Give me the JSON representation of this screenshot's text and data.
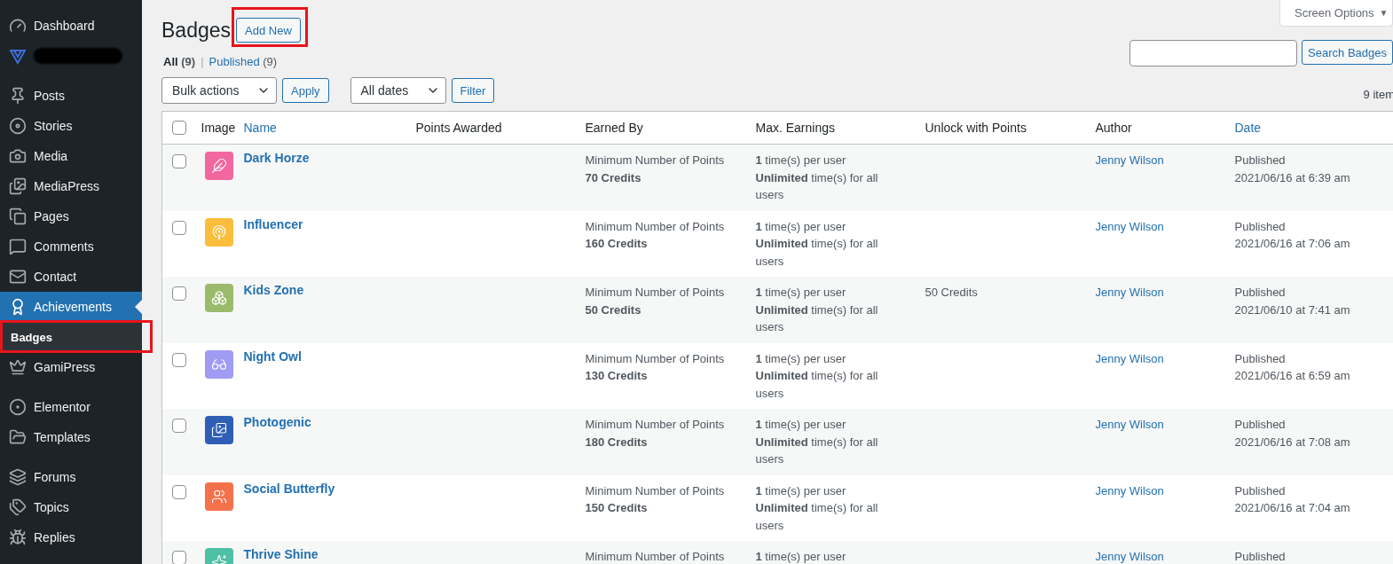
{
  "sidebar": {
    "groups": [
      [
        {
          "label": "Dashboard",
          "selected": false
        },
        {
          "kind": "redacted",
          "selected": false
        }
      ],
      [
        {
          "label": "Posts",
          "selected": false
        },
        {
          "label": "Stories",
          "selected": false
        },
        {
          "label": "Media",
          "selected": false
        },
        {
          "label": "MediaPress",
          "selected": false
        },
        {
          "label": "Pages",
          "selected": false
        },
        {
          "label": "Comments",
          "selected": false
        },
        {
          "label": "Contact",
          "selected": false
        },
        {
          "label": "Achievements",
          "selected": true,
          "children": [
            {
              "label": "Badges",
              "selected": true,
              "highlighted": true
            }
          ]
        },
        {
          "label": "GamiPress",
          "selected": false
        }
      ],
      [
        {
          "label": "Elementor",
          "selected": false
        },
        {
          "label": "Templates",
          "selected": false
        }
      ],
      [
        {
          "label": "Forums",
          "selected": false
        },
        {
          "label": "Topics",
          "selected": false
        },
        {
          "label": "Replies",
          "selected": false
        }
      ]
    ]
  },
  "page_title": "Badges",
  "add_new": {
    "label": "Add New",
    "highlighted": true
  },
  "screen_options": {
    "label": "Screen Options",
    "caret": "▼"
  },
  "views": [
    {
      "label": "All",
      "count": "(9)",
      "selected": true
    },
    {
      "label": "Published",
      "count": "(9)",
      "selected": false
    }
  ],
  "views_separator": "|",
  "bulk_actions": {
    "value": "Bulk actions",
    "button": "Apply"
  },
  "date_filter": {
    "value": "All dates",
    "button": "Filter"
  },
  "search": {
    "button": "Search Badges"
  },
  "item_count": "9 item",
  "table": {
    "select_all": {
      "checked": false
    },
    "columns": [
      {
        "label": "Image",
        "sortable": false
      },
      {
        "label": "Name",
        "sortable": true
      },
      {
        "label": "Points Awarded",
        "sortable": false
      },
      {
        "label": "Earned By",
        "sortable": false
      },
      {
        "label": "Max. Earnings",
        "sortable": false
      },
      {
        "label": "Unlock with Points",
        "sortable": false
      },
      {
        "label": "Author",
        "sortable": false
      },
      {
        "label": "Date",
        "sortable": true
      }
    ],
    "rows": [
      {
        "name": "Dark Horze",
        "color": "#f2679f",
        "earned_by": [
          "Minimum Number of Points",
          "70 Credits"
        ],
        "max_earnings": [
          "**1** time(s) per user",
          "**Unlimited** time(s) for all users"
        ],
        "author": "Jenny Wilson",
        "date": [
          "Published",
          "2021/06/16 at 6:39 am"
        ],
        "checked": false
      },
      {
        "name": "Influencer",
        "color": "#fbbd3c",
        "earned_by": [
          "Minimum Number of Points",
          "160 Credits"
        ],
        "max_earnings": [
          "**1** time(s) per user",
          "**Unlimited** time(s) for all users"
        ],
        "author": "Jenny Wilson",
        "date": [
          "Published",
          "2021/06/16 at 7:06 am"
        ],
        "checked": false
      },
      {
        "name": "Kids Zone",
        "color": "#9bbb6c",
        "earned_by": [
          "Minimum Number of Points",
          "50 Credits"
        ],
        "max_earnings": [
          "**1** time(s) per user",
          "**Unlimited** time(s) for all users"
        ],
        "unlock": "50 Credits",
        "author": "Jenny Wilson",
        "date": [
          "Published",
          "2021/06/10 at 7:41 am"
        ],
        "checked": false
      },
      {
        "name": "Night Owl",
        "color": "#a09bf3",
        "earned_by": [
          "Minimum Number of Points",
          "130 Credits"
        ],
        "max_earnings": [
          "**1** time(s) per user",
          "**Unlimited** time(s) for all users"
        ],
        "author": "Jenny Wilson",
        "date": [
          "Published",
          "2021/06/16 at 6:59 am"
        ],
        "checked": false
      },
      {
        "name": "Photogenic",
        "color": "#2f5fb5",
        "earned_by": [
          "Minimum Number of Points",
          "180 Credits"
        ],
        "max_earnings": [
          "**1** time(s) per user",
          "**Unlimited** time(s) for all users"
        ],
        "author": "Jenny Wilson",
        "date": [
          "Published",
          "2021/06/16 at 7:08 am"
        ],
        "checked": false
      },
      {
        "name": "Social Butterfly",
        "color": "#f5714b",
        "earned_by": [
          "Minimum Number of Points",
          "150 Credits"
        ],
        "max_earnings": [
          "**1** time(s) per user",
          "**Unlimited** time(s) for all users"
        ],
        "author": "Jenny Wilson",
        "date": [
          "Published",
          "2021/06/16 at 7:04 am"
        ],
        "checked": false
      },
      {
        "name": "Thrive Shine",
        "color": "#4fbfa5",
        "earned_by": [
          "Minimum Number of Points"
        ],
        "max_earnings": [
          "**1** time(s) per user"
        ],
        "author": "Jenny Wilson",
        "date": [
          "Published"
        ],
        "checked": false
      }
    ]
  }
}
